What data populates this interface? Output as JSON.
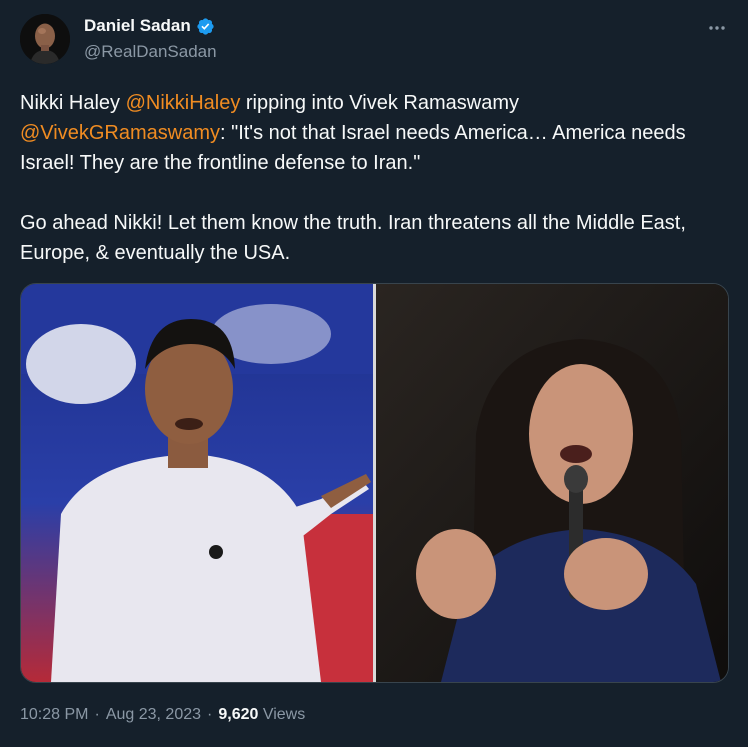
{
  "author": {
    "display_name": "Daniel Sadan",
    "handle": "@RealDanSadan",
    "verified": true
  },
  "tweet": {
    "text_seg1": "Nikki Haley ",
    "mention1": "@NikkiHaley",
    "text_seg2": " ripping into Vivek Ramaswamy ",
    "mention2": "@VivekGRamaswamy",
    "text_seg3": ": \"It's not that Israel needs America… America needs Israel! They are the frontline defense to Iran.\"",
    "paragraph2": "Go ahead Nikki! Let them know the truth. Iran threatens all the Middle East, Europe, & eventually the USA."
  },
  "media": {
    "left_subject": "man in light button-down shirt pointing",
    "right_subject": "woman in navy top speaking into microphone"
  },
  "meta": {
    "time": "10:28 PM",
    "separator1": "·",
    "date": "Aug 23, 2023",
    "separator2": "·",
    "views_count": "9,620",
    "views_label": "Views"
  },
  "colors": {
    "background": "#15202b",
    "mention": "#f08c22",
    "verified": "#1d9bf0",
    "secondary_text": "#8b98a5"
  },
  "icons": {
    "more": "more-horizontal-icon",
    "verified": "verified-badge-icon"
  }
}
